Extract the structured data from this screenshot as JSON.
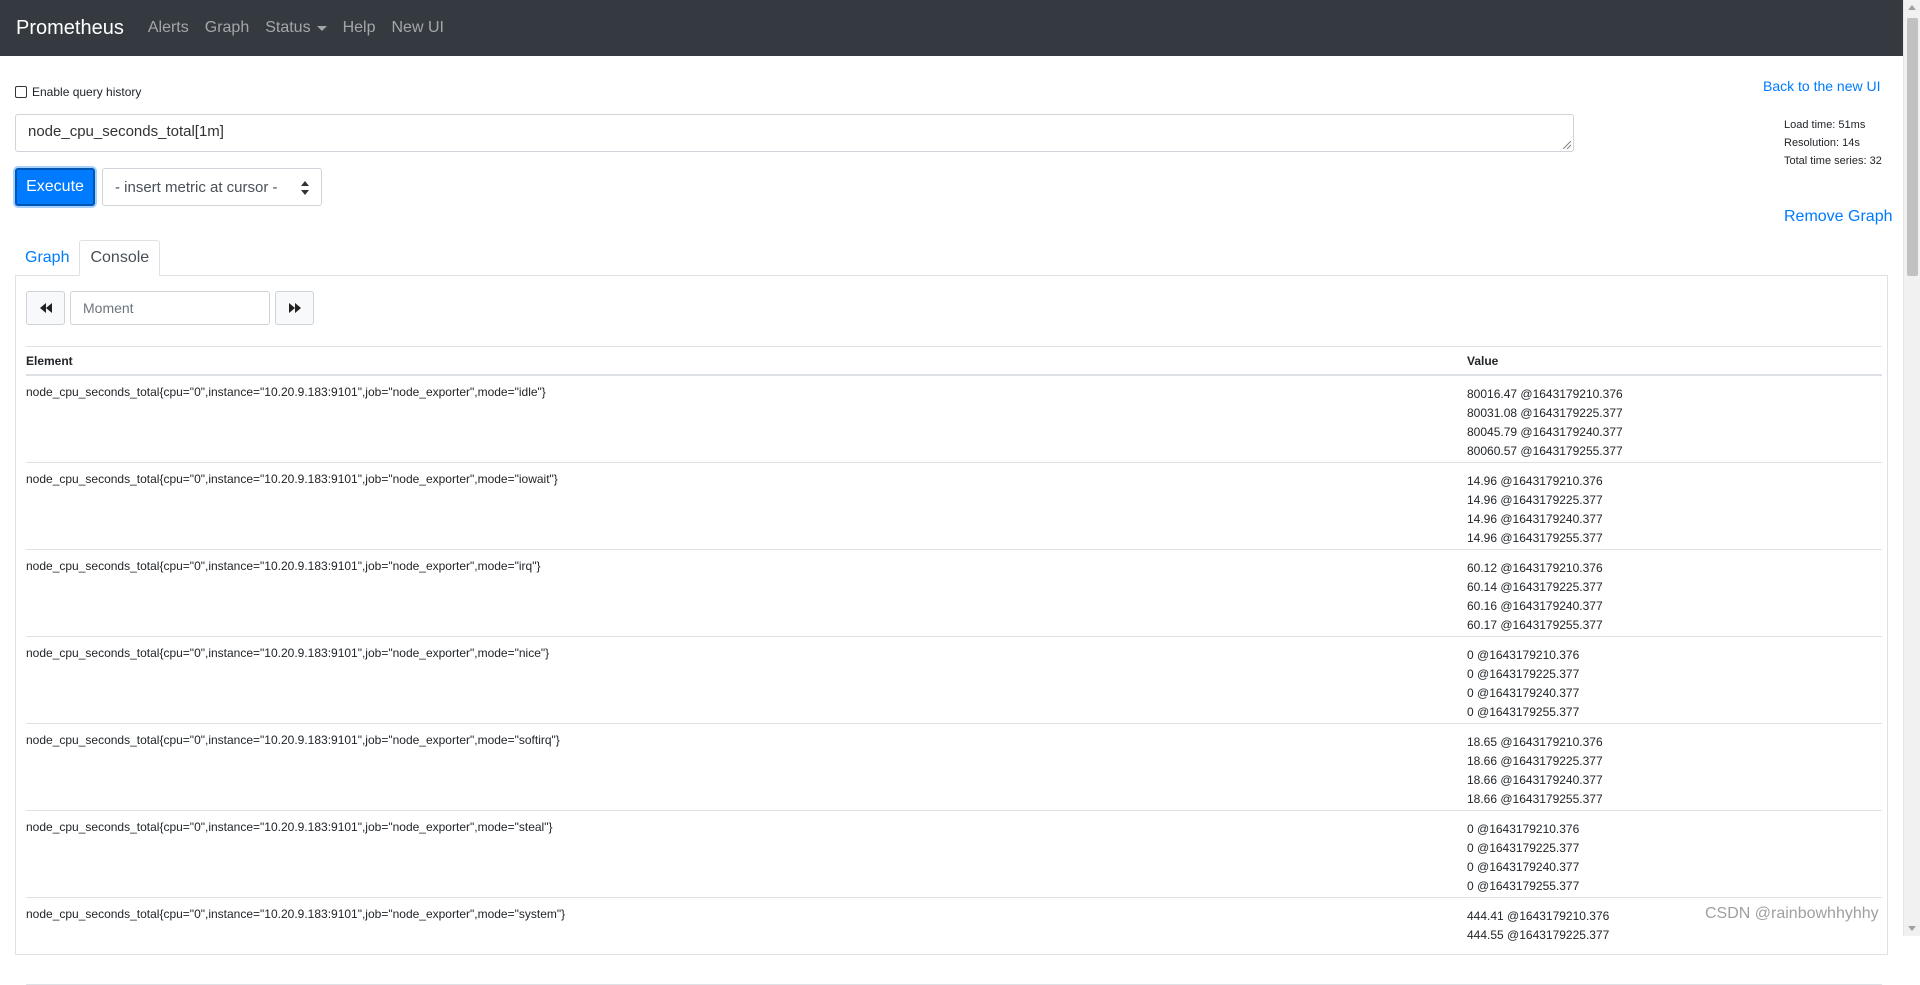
{
  "navbar": {
    "brand": "Prometheus",
    "links": [
      "Alerts",
      "Graph",
      "Status",
      "Help",
      "New UI"
    ]
  },
  "query": {
    "history_label": "Enable query history",
    "expression": "node_cpu_seconds_total[1m]",
    "execute_label": "Execute",
    "metric_select": "- insert metric at cursor -"
  },
  "side": {
    "back_link": "Back to the new UI",
    "load_time": "Load time: 51ms",
    "resolution": "Resolution: 14s",
    "total_series": "Total time series: 32",
    "remove_graph": "Remove Graph"
  },
  "tabs": {
    "graph": "Graph",
    "console": "Console"
  },
  "console": {
    "moment_placeholder": "Moment",
    "headers": {
      "element": "Element",
      "value": "Value"
    },
    "rows": [
      {
        "element": "node_cpu_seconds_total{cpu=\"0\",instance=\"10.20.9.183:9101\",job=\"node_exporter\",mode=\"idle\"}",
        "values": [
          "80016.47 @1643179210.376",
          "80031.08 @1643179225.377",
          "80045.79 @1643179240.377",
          "80060.57 @1643179255.377"
        ]
      },
      {
        "element": "node_cpu_seconds_total{cpu=\"0\",instance=\"10.20.9.183:9101\",job=\"node_exporter\",mode=\"iowait\"}",
        "values": [
          "14.96 @1643179210.376",
          "14.96 @1643179225.377",
          "14.96 @1643179240.377",
          "14.96 @1643179255.377"
        ]
      },
      {
        "element": "node_cpu_seconds_total{cpu=\"0\",instance=\"10.20.9.183:9101\",job=\"node_exporter\",mode=\"irq\"}",
        "values": [
          "60.12 @1643179210.376",
          "60.14 @1643179225.377",
          "60.16 @1643179240.377",
          "60.17 @1643179255.377"
        ]
      },
      {
        "element": "node_cpu_seconds_total{cpu=\"0\",instance=\"10.20.9.183:9101\",job=\"node_exporter\",mode=\"nice\"}",
        "values": [
          "0 @1643179210.376",
          "0 @1643179225.377",
          "0 @1643179240.377",
          "0 @1643179255.377"
        ]
      },
      {
        "element": "node_cpu_seconds_total{cpu=\"0\",instance=\"10.20.9.183:9101\",job=\"node_exporter\",mode=\"softirq\"}",
        "values": [
          "18.65 @1643179210.376",
          "18.66 @1643179225.377",
          "18.66 @1643179240.377",
          "18.66 @1643179255.377"
        ]
      },
      {
        "element": "node_cpu_seconds_total{cpu=\"0\",instance=\"10.20.9.183:9101\",job=\"node_exporter\",mode=\"steal\"}",
        "values": [
          "0 @1643179210.376",
          "0 @1643179225.377",
          "0 @1643179240.377",
          "0 @1643179255.377"
        ]
      },
      {
        "element": "node_cpu_seconds_total{cpu=\"0\",instance=\"10.20.9.183:9101\",job=\"node_exporter\",mode=\"system\"}",
        "values": [
          "444.41 @1643179210.376",
          "444.55 @1643179225.377"
        ]
      }
    ]
  },
  "watermark": "CSDN @rainbowhhyhhy",
  "colors": {
    "navbar": "#343a40",
    "primary": "#007bff",
    "border": "#dee2e6"
  }
}
